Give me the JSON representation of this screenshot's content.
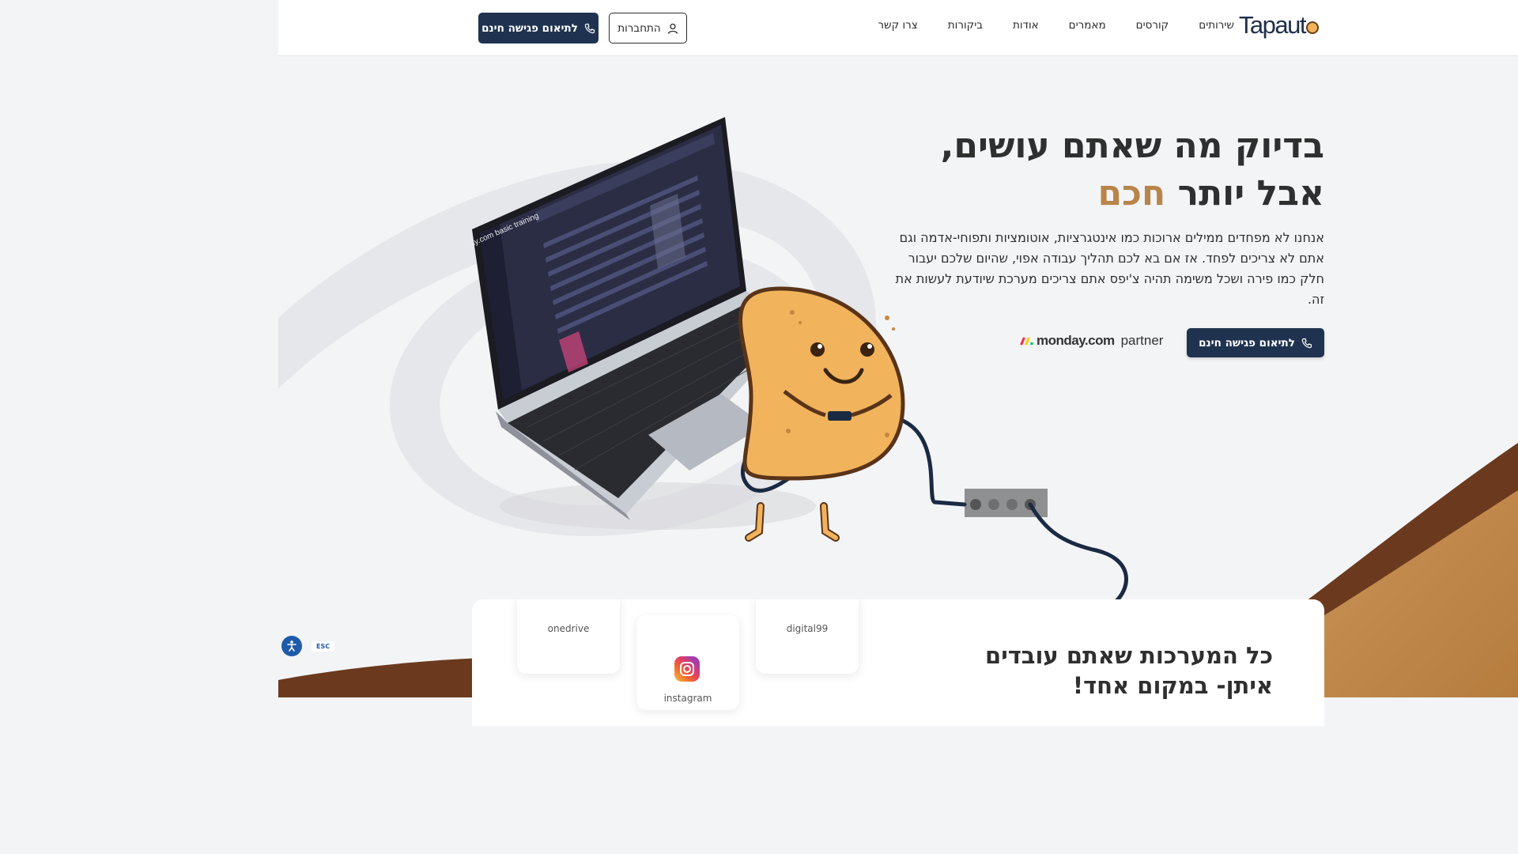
{
  "header": {
    "logo_text": "Tapaut",
    "nav": [
      "שירותים",
      "קורסים",
      "מאמרים",
      "אודות",
      "ביקורות",
      "צרו קשר"
    ],
    "login_label": "התחברות",
    "cta_label": "לתיאום פגישה חינם"
  },
  "hero": {
    "title_line1": "בדיוק מה שאתם עושים,",
    "title_line2_prefix": "אבל יותר",
    "title_line2_accent": "חכם",
    "description": "אנחנו לא מפחדים ממילים ארוכות כמו אינטגרציות, אוטומציות ותפוחי-אדמה וגם אתם לא צריכים לפחד. אז אם בא לכם תהליך עבודה אפוי, שהיום שלכם יעבור חלק כמו פירה ושכל משימה תהיה צ'יפס אתם צריכים מערכת שיודעת לעשות את זה.",
    "cta_label": "לתיאום פגישה חינם",
    "partner_brand": "monday.com",
    "partner_word": "partner"
  },
  "laptop_screen": {
    "title": "monday.com basic training"
  },
  "integrations": {
    "title": "כל המערכות שאתם עובדים איתן- במקום אחד!",
    "tiles": [
      "onedrive",
      "digital99",
      "instagram"
    ]
  },
  "accessibility": {
    "esc_label": "ESC"
  },
  "colors": {
    "primary": "#1f3350",
    "accent": "#b8844a",
    "brown_dark": "#6b3a1e"
  }
}
